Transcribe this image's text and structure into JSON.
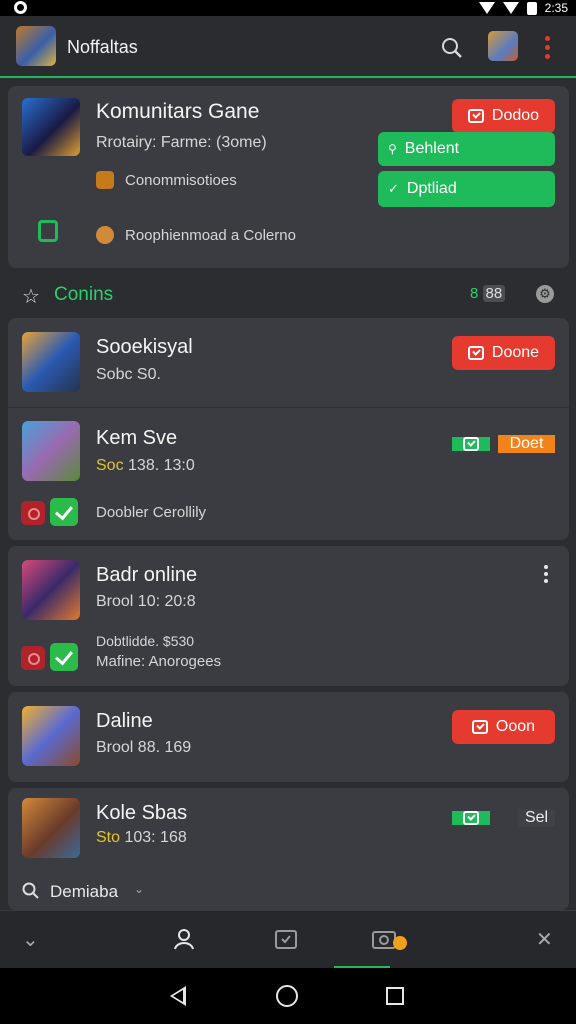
{
  "status_bar": {
    "time": "2:35"
  },
  "app_bar": {
    "title": "Noffaltas"
  },
  "featured": {
    "name": "Komunitars Gane",
    "subtitle": "Rrotairy: Farme: (3ome)",
    "line1": "Conommisotioes",
    "line2": "Roophienmoad a Colerno",
    "btn_red": "Dodoo",
    "btn_green1": "Behlent",
    "btn_green2": "Dptliad"
  },
  "section": {
    "label": "Conins",
    "count_prefix": "8",
    "count_box": "88"
  },
  "games": [
    {
      "name": "Sooekisyal",
      "sub": "Sobc S0.",
      "button": "Doone"
    },
    {
      "name": "Kem Sve",
      "sub_yellow": "Soc",
      "sub_rest": "138.   13:0",
      "button": "Doet",
      "extra": "Doobler Cerollily"
    },
    {
      "name": "Badr online",
      "sub": "Brool 10:   20:8",
      "line2": "Dobtlidde.   $530",
      "line3": "Mafine: Anorogees"
    },
    {
      "name": "Daline",
      "sub": "Brool 88.   169",
      "button": "Ooon"
    },
    {
      "name": "Kole Sbas",
      "sub_yellow": "Sto",
      "sub_rest": "103:   168",
      "button": "Sel"
    }
  ],
  "sort": {
    "label": "Demiaba"
  }
}
